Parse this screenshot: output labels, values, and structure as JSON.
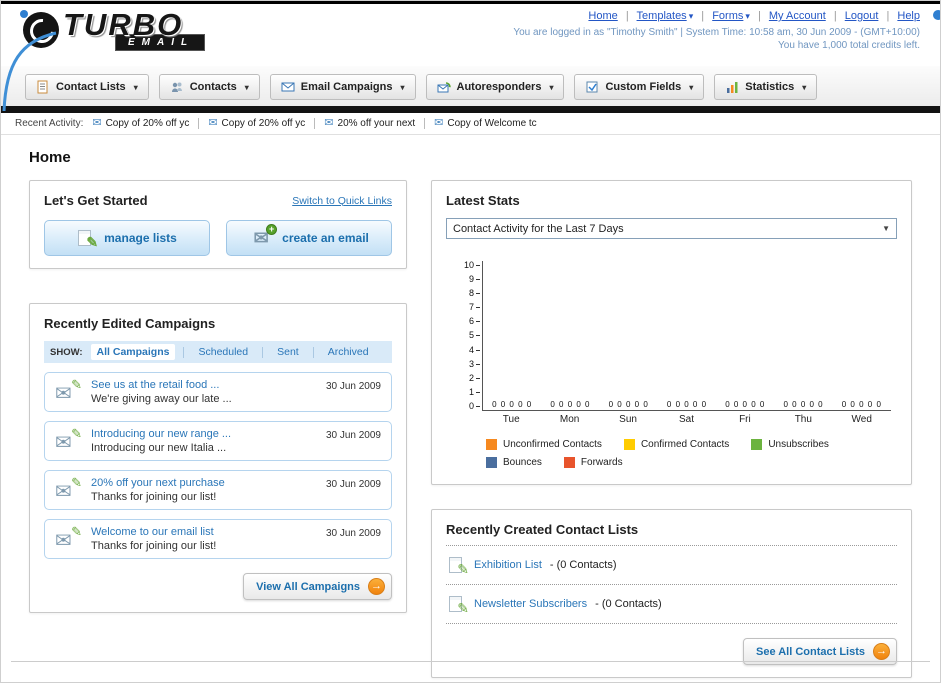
{
  "icons": {
    "caret": "▾",
    "envelope": "✉",
    "pencil": "✎",
    "plus": "+",
    "arrow_right": "→",
    "select_arrow": "▼"
  },
  "header": {
    "logo_title": "TURBO",
    "logo_subtitle": "EMAIL",
    "links": [
      "Home",
      "Templates",
      "Forms",
      "My Account",
      "Logout",
      "Help"
    ],
    "separator": "|",
    "login_info": "You are logged in as \"Timothy Smith\" | System Time: 10:58 am, 30 Jun 2009 - (GMT+10:00)",
    "credits_info": "You have 1,000 total credits left."
  },
  "main_nav": {
    "items": [
      {
        "label": "Contact Lists"
      },
      {
        "label": "Contacts"
      },
      {
        "label": "Email Campaigns"
      },
      {
        "label": "Autoresponders"
      },
      {
        "label": "Custom Fields"
      },
      {
        "label": "Statistics"
      }
    ]
  },
  "recent_activity": {
    "label": "Recent Activity:",
    "items": [
      "Copy of 20% off yc",
      "Copy of 20% off yc",
      "20% off your next",
      "Copy of Welcome tc"
    ]
  },
  "page": {
    "title": "Home"
  },
  "get_started": {
    "title": "Let's Get Started",
    "switch_link": "Switch to Quick Links",
    "manage_lists_label": "manage lists",
    "create_email_label": "create an email"
  },
  "campaigns": {
    "title": "Recently Edited Campaigns",
    "show_label": "SHOW:",
    "tabs": [
      "All Campaigns",
      "Scheduled",
      "Sent",
      "Archived"
    ],
    "items": [
      {
        "title": "See us at the retail food ...",
        "subtitle": "We're giving away our late ...",
        "date": "30 Jun 2009"
      },
      {
        "title": "Introducing our new range ...",
        "subtitle": "Introducing our new Italia ...",
        "date": "30 Jun 2009"
      },
      {
        "title": "20% off your next purchase",
        "subtitle": "Thanks for joining our list!",
        "date": "30 Jun 2009"
      },
      {
        "title": "Welcome to our email list",
        "subtitle": "Thanks for joining our list!",
        "date": "30 Jun 2009"
      }
    ],
    "view_all_label": "View All Campaigns"
  },
  "stats": {
    "title": "Latest Stats",
    "period_selector": "Contact Activity for the Last 7 Days",
    "chart_data": {
      "type": "bar",
      "title": "Contact Activity for the Last 7 Days",
      "categories": [
        "Tue",
        "Mon",
        "Sun",
        "Sat",
        "Fri",
        "Thu",
        "Wed"
      ],
      "series": [
        {
          "name": "Unconfirmed Contacts",
          "color": "#F6891F",
          "values": [
            0,
            0,
            0,
            0,
            0,
            0,
            0
          ]
        },
        {
          "name": "Confirmed Contacts",
          "color": "#FFCC00",
          "values": [
            0,
            0,
            0,
            0,
            0,
            0,
            0
          ]
        },
        {
          "name": "Unsubscribes",
          "color": "#6CB33F",
          "values": [
            0,
            0,
            0,
            0,
            0,
            0,
            0
          ]
        },
        {
          "name": "Bounces",
          "color": "#4A6E9E",
          "values": [
            0,
            0,
            0,
            0,
            0,
            0,
            0
          ]
        },
        {
          "name": "Forwards",
          "color": "#E8542C",
          "values": [
            0,
            0,
            0,
            0,
            0,
            0,
            0
          ]
        }
      ],
      "ylim": [
        0,
        10
      ],
      "yticks": [
        10,
        9,
        8,
        7,
        6,
        5,
        4,
        3,
        2,
        1,
        0
      ],
      "legend_position": "bottom",
      "grid": false
    }
  },
  "contact_lists": {
    "title": "Recently Created Contact Lists",
    "items": [
      {
        "name": "Exhibition List",
        "detail": "- (0 Contacts)"
      },
      {
        "name": "Newsletter Subscribers",
        "detail": "- (0 Contacts)"
      }
    ],
    "see_all_label": "See All Contact Lists"
  }
}
